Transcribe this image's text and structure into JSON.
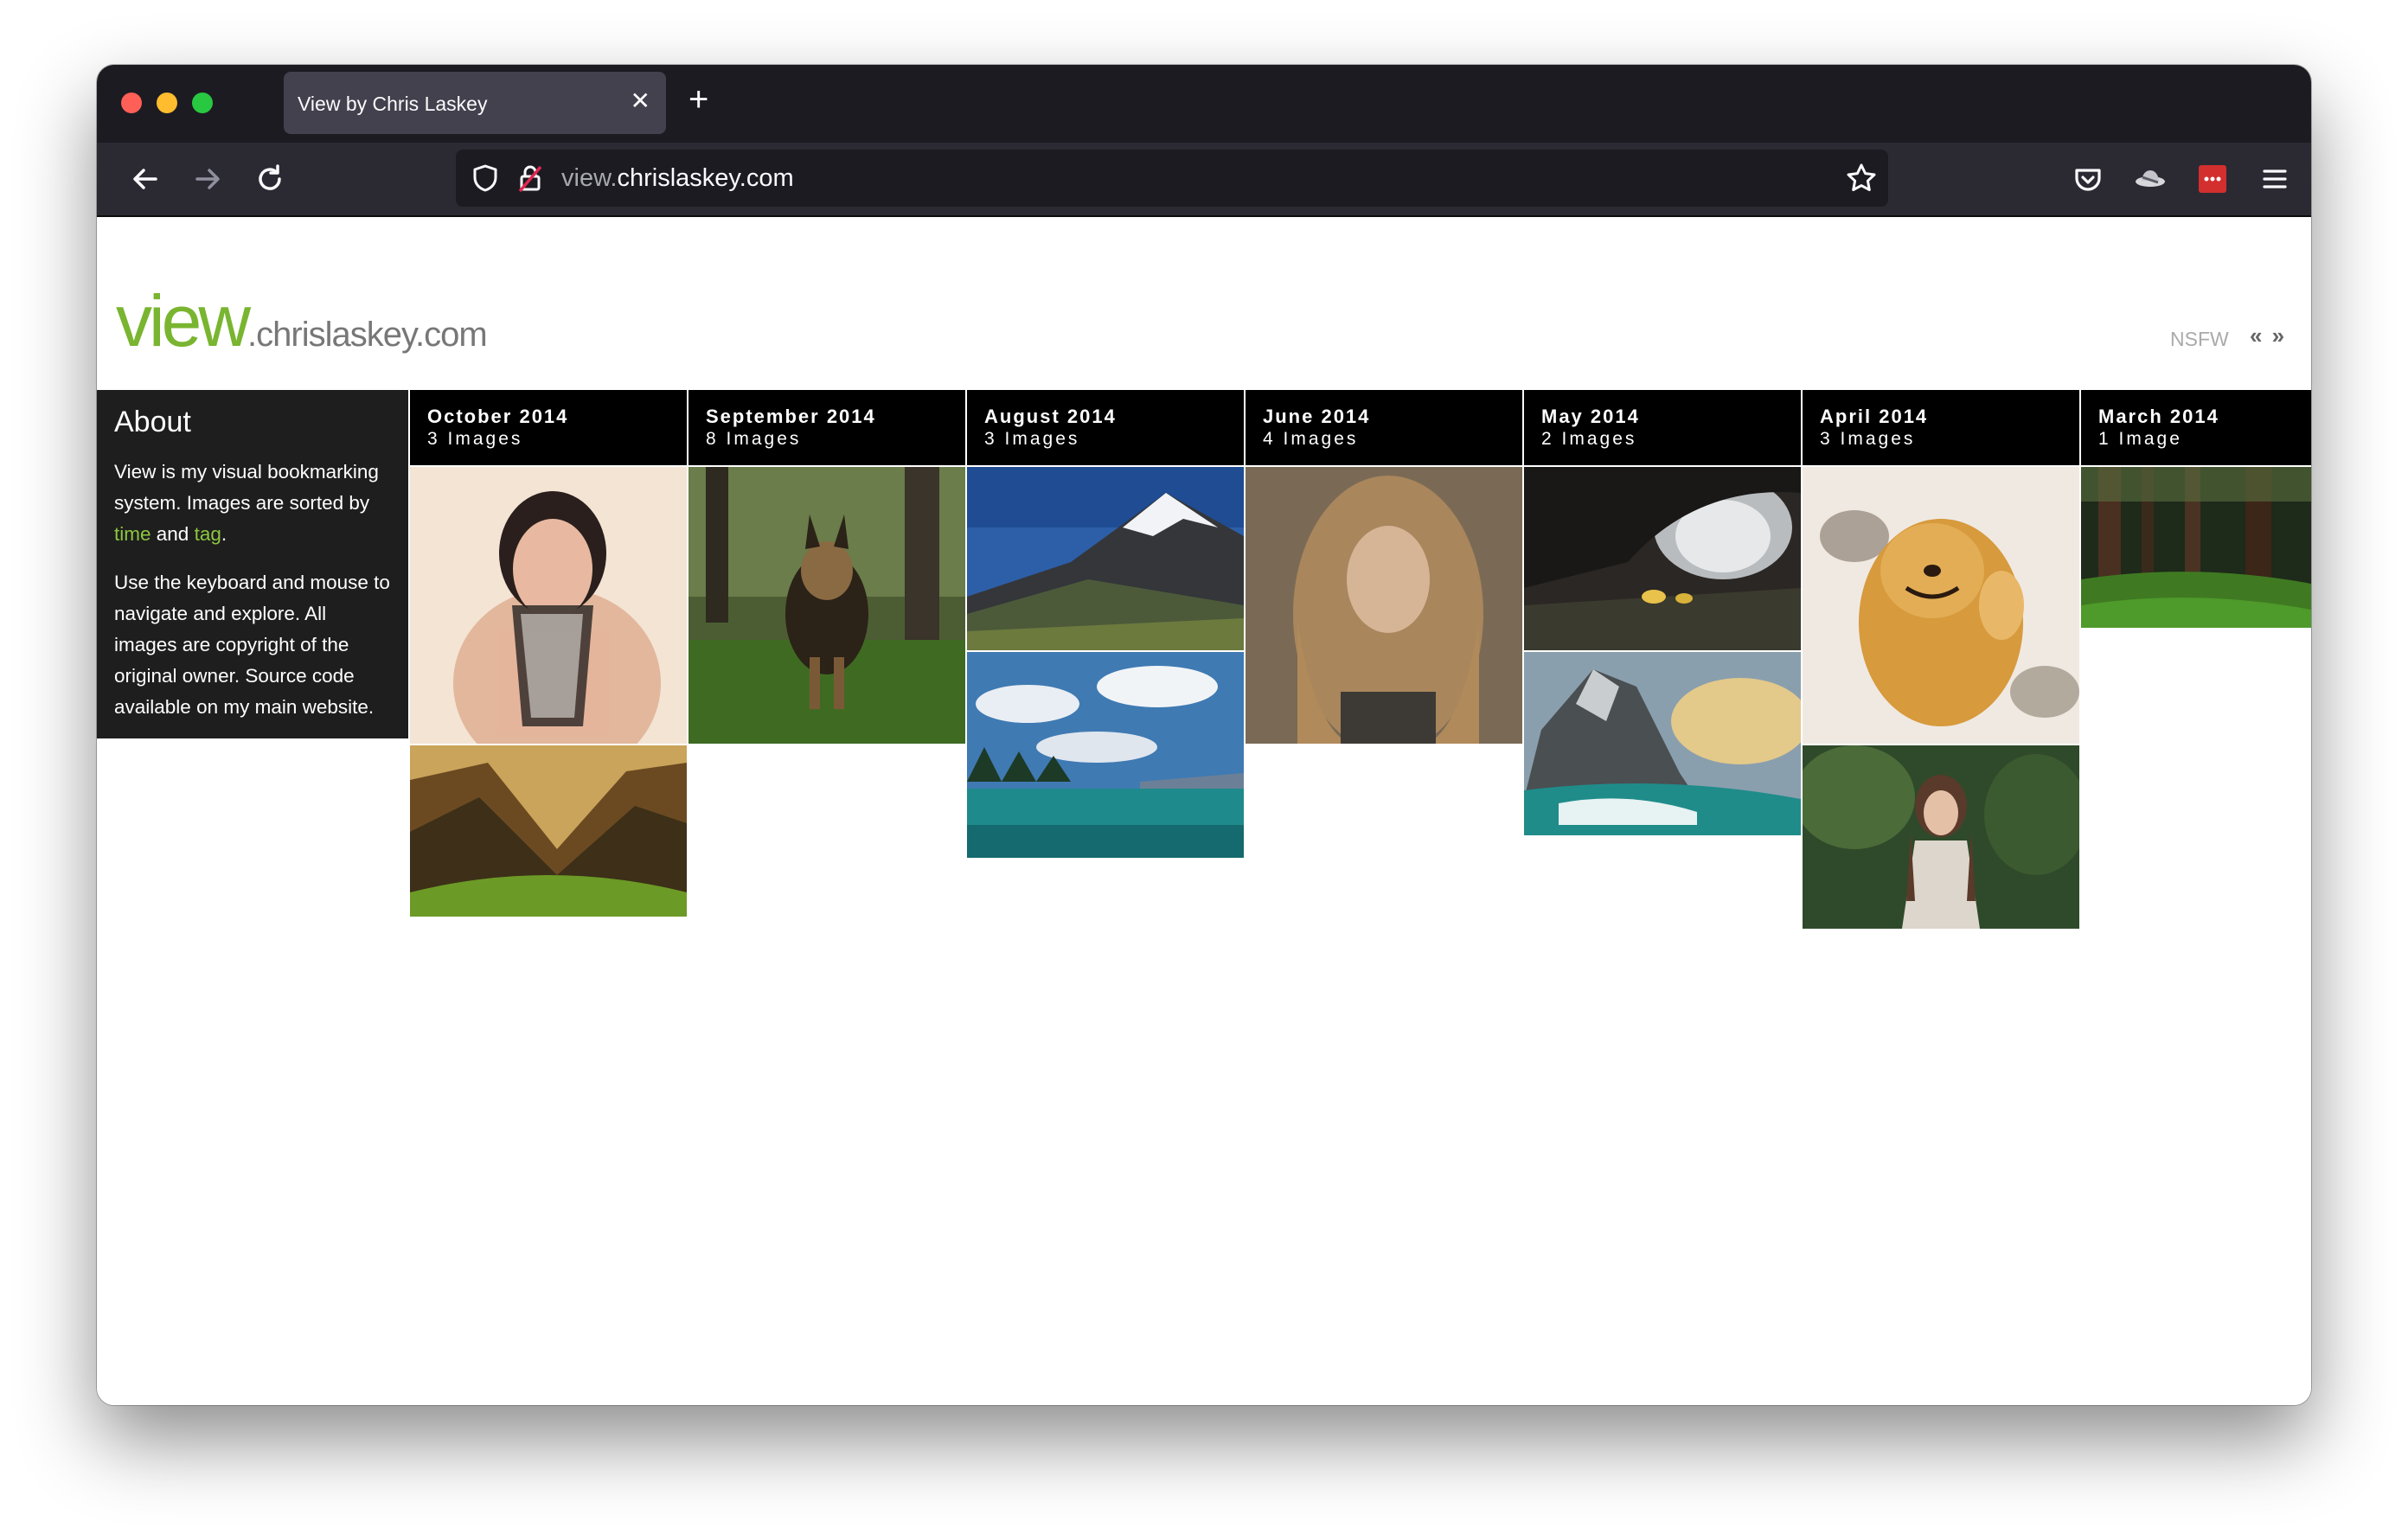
{
  "browser": {
    "tab_title": "View by Chris Laskey",
    "url_prefix": "view.",
    "url_domain": "chrislaskey.com"
  },
  "site": {
    "logo_main": "view",
    "logo_suffix": ".chrislaskey.com",
    "nsfw_label": "NSFW",
    "pager_label": "« »",
    "accent_color": "#79b530"
  },
  "about": {
    "title": "About",
    "p1_text": "View is my visual bookmarking system. Images are sorted by ",
    "p1_link_time": "time",
    "p1_and": " and ",
    "p1_link_tag": "tag",
    "p1_end": ".",
    "p2": "Use the keyboard and mouse to navigate and explore. All images are copyright of the original owner. Source code available on my main website."
  },
  "columns": [
    {
      "month": "October 2014",
      "count": "3 Images"
    },
    {
      "month": "September 2014",
      "count": "8 Images"
    },
    {
      "month": "August 2014",
      "count": "3 Images"
    },
    {
      "month": "June 2014",
      "count": "4 Images"
    },
    {
      "month": "May 2014",
      "count": "2 Images"
    },
    {
      "month": "April 2014",
      "count": "3 Images"
    },
    {
      "month": "March 2014",
      "count": "1 Image"
    }
  ]
}
